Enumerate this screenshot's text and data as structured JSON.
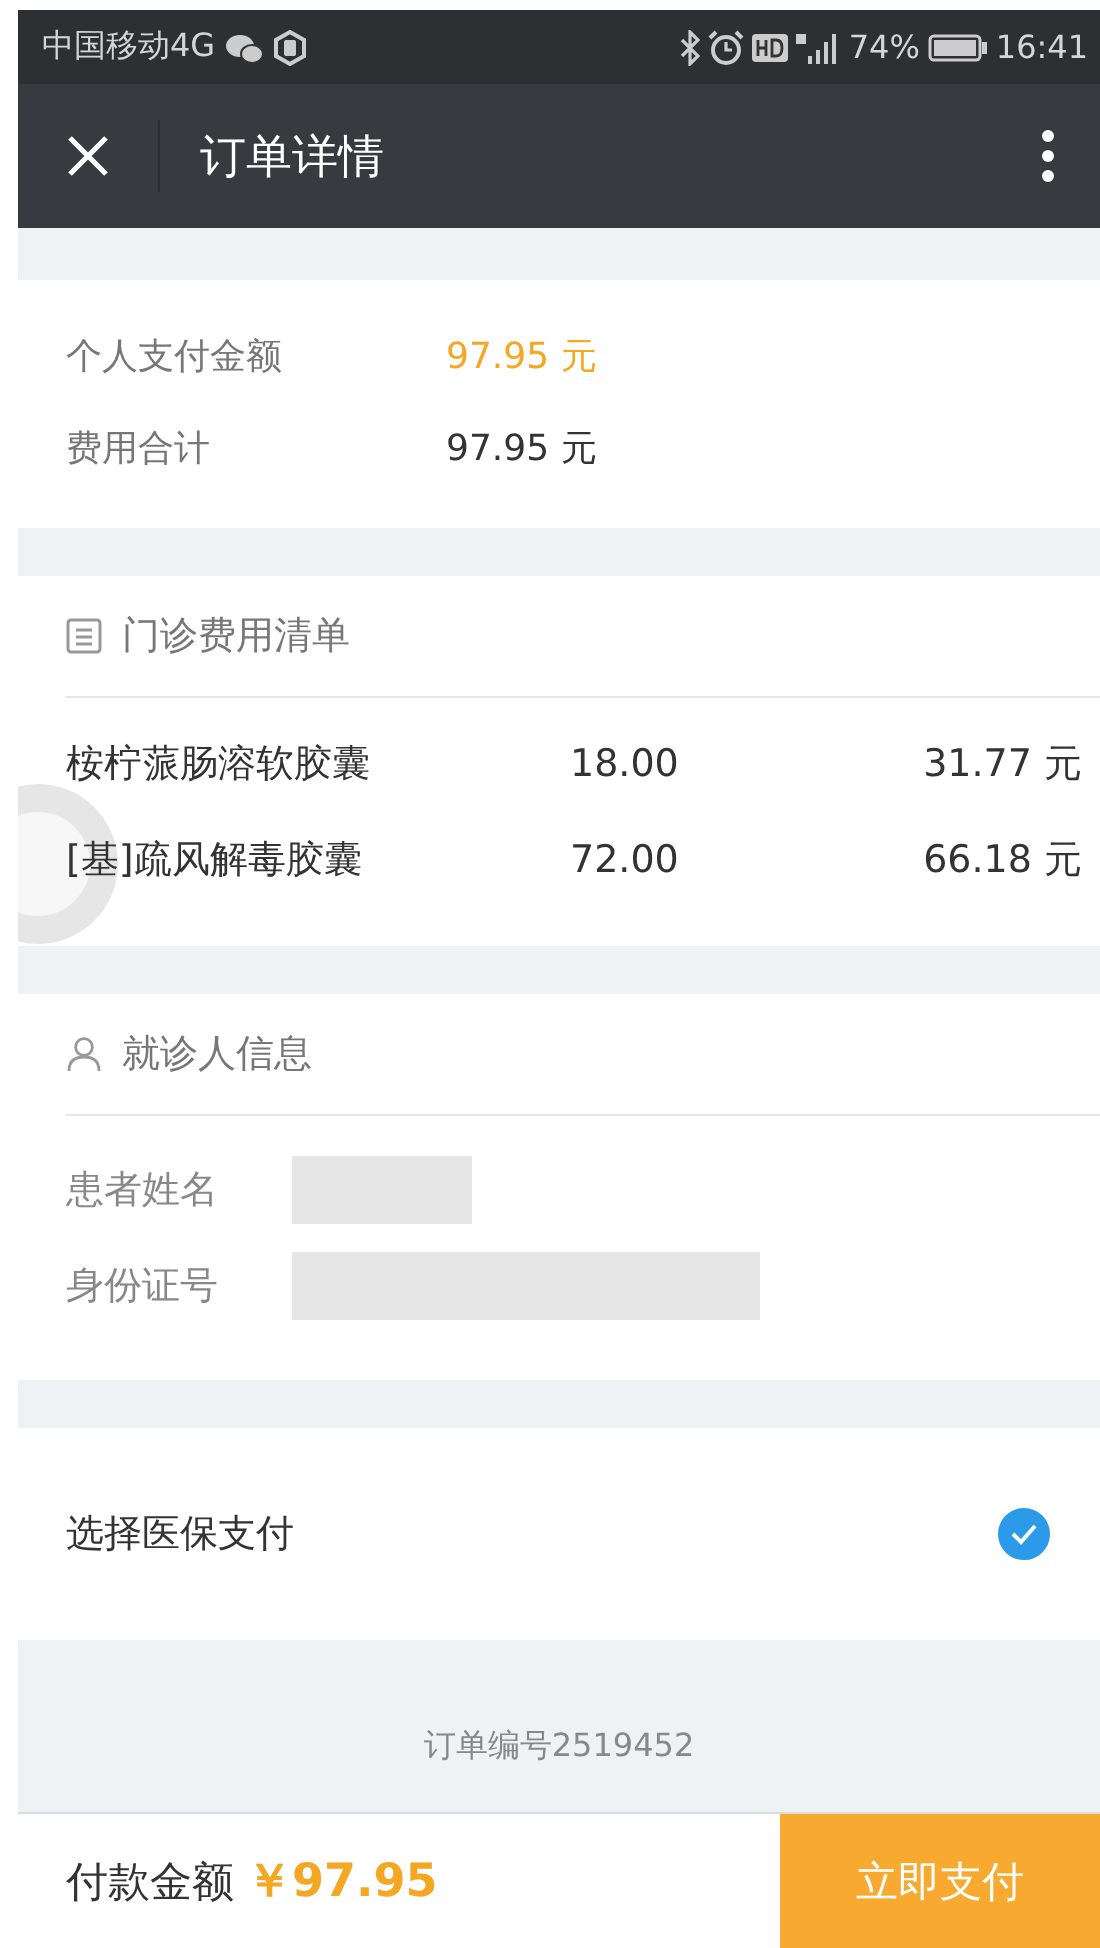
{
  "status_bar": {
    "carrier": "中国移动4G",
    "battery": "74%",
    "time": "16:41"
  },
  "nav_bar": {
    "title": "订单详情"
  },
  "summary": [
    {
      "label": "个人支付金额",
      "value": "97.95 元",
      "emphasized": true
    },
    {
      "label": "费用合计",
      "value": "97.95 元",
      "emphasized": false
    }
  ],
  "fee_list": {
    "title": "门诊费用清单",
    "rows": [
      {
        "name": "桉柠蒎肠溶软胶囊",
        "column_2": "18.00",
        "amount": "31.77 元"
      },
      {
        "name": "[基]疏风解毒胶囊",
        "column_2": "72.00",
        "amount": "66.18 元"
      }
    ]
  },
  "patient": {
    "title": "就诊人信息",
    "fields": [
      {
        "label": "患者姓名"
      },
      {
        "label": "身份证号"
      }
    ]
  },
  "insurance": {
    "label": "选择医保支付",
    "checked": true
  },
  "order_number": "订单编号2519452",
  "footer": {
    "label": "付款金额",
    "amount": "￥97.95",
    "button": "立即支付"
  }
}
